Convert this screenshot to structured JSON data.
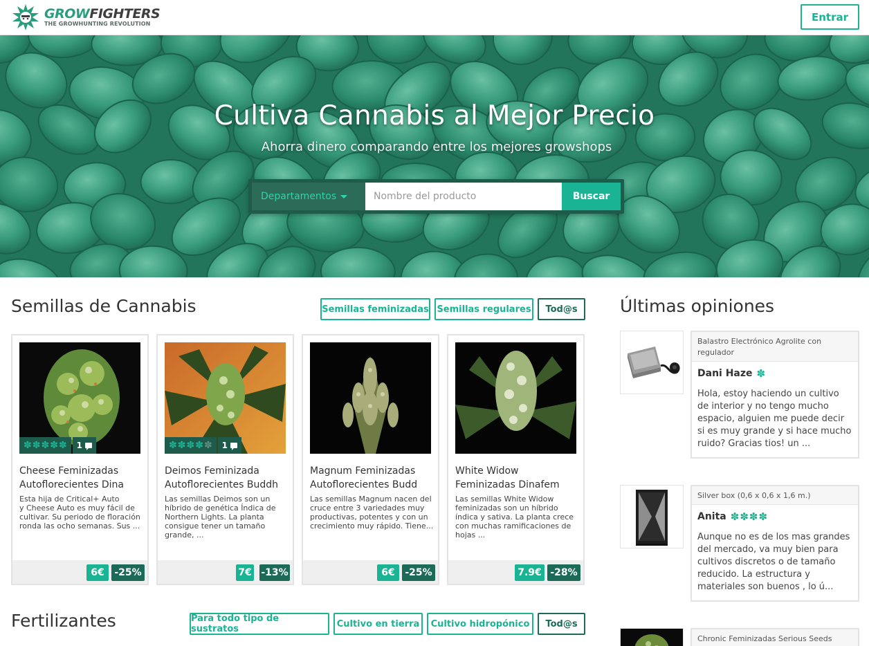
{
  "header": {
    "logo_name_accent": "GROW",
    "logo_name_dark": "FIGHTERS",
    "logo_tagline": "THE GROWHUNTING REVOLUTION",
    "login_label": "Entrar"
  },
  "hero": {
    "title": "Cultiva Cannabis al Mejor Precio",
    "subtitle": "Ahorra dinero comparando entre los mejores growshops",
    "search": {
      "department_label": "Departamentos",
      "placeholder": "Nombre del producto",
      "button_label": "Buscar"
    }
  },
  "seeds": {
    "title": "Semillas de Cannabis",
    "filters": [
      "Semillas feminizadas",
      "Semillas regulares",
      "Tod@s"
    ],
    "products": [
      {
        "name": "Cheese Feminizadas\nAutoflorecientes Dina",
        "description": "Esta hija de Critical+ Auto\ny Cheese Auto es muy fácil de cultivar. Su periodo de floración ronda las ocho semanas. Sus ...",
        "rating": 5,
        "comments": "1",
        "price": "6€",
        "discount": "-25%"
      },
      {
        "name": "Deimos Feminizada\nAutoflorecientes Buddh",
        "description": "Las semillas Deimos son un híbrido de genética Índica de Northern Lights.    La planta consigue tener un tamaño grande, ...",
        "rating": 4,
        "comments": "1",
        "price": "7€",
        "discount": "-13%"
      },
      {
        "name": "Magnum Feminizadas\nAutoflorecientes Budd",
        "description": "Las semillas Magnum nacen del cruce entre 3 variedades muy productivas, potentes y con un crecimiento muy rápido.  Tiene...",
        "rating": 0,
        "comments": "",
        "price": "6€",
        "discount": "-25%"
      },
      {
        "name": "White Widow\nFeminizadas Dinafem",
        "description": "Las semillas White Widow feminizadas son un híbrido índica y sativa. La planta crece con muchas ramificaciones de hojas ...",
        "rating": 0,
        "comments": "",
        "price": "7.9€",
        "discount": "-28%"
      }
    ]
  },
  "fertilizers": {
    "title": "Fertilizantes",
    "filters": [
      "Para todo tipo de sustratos",
      "Cultivo en tierra",
      "Cultivo hidropónico",
      "Tod@s"
    ]
  },
  "opinions": {
    "title": "Últimas opiniones",
    "items": [
      {
        "product": "Balastro Electrónico Agrolite con regulador",
        "user": "Dani Haze",
        "leaves": "✽",
        "text": "Hola, estoy haciendo un cultivo de interior y no tengo mucho espacio, alguien me puede decir si es muy grande y si hace mucho ruido? Gracias tios! un ..."
      },
      {
        "product": "Silver box (0,6 x 0,6 x 1,6 m.)",
        "user": "Anita",
        "leaves": "✽✽✽✽",
        "text": "Aunque no es de los mas grandes del mercado, va muy bien para cultivos discretos o de tamaño reducido. La estructura y materiales son buenos , lo ú..."
      },
      {
        "product": "Chronic Feminizadas Serious Seeds",
        "user": "",
        "leaves": "",
        "text": ""
      }
    ]
  },
  "colors": {
    "accent": "#1ab394",
    "dark_accent": "#1b6b58",
    "hero_tint": "#2e8f6f"
  }
}
